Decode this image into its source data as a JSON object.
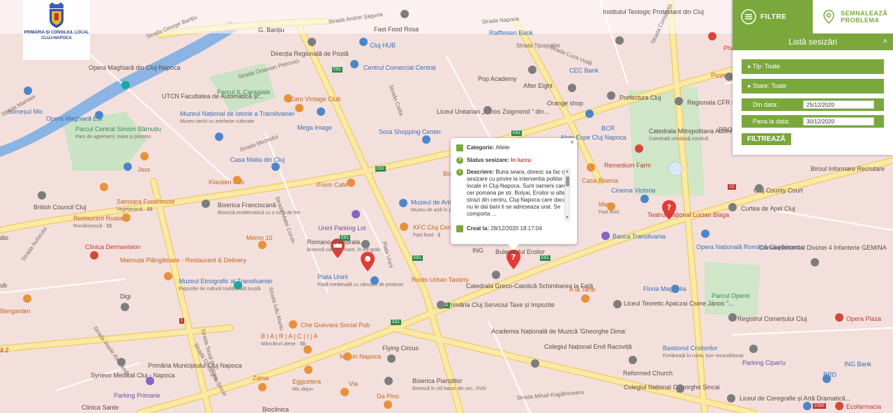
{
  "logo": {
    "line1": "PRIMĂRIA ȘI CONSILIUL LOCAL",
    "line2": "CLUJ-NAPOCA"
  },
  "panel": {
    "tab_filters": "FILTRE",
    "tab_report_line1": "SEMNALEAZĂ",
    "tab_report_line2": "PROBLEMA",
    "list_title": "Listă sesizări",
    "type_filter": "Tip: Toate",
    "state_filter": "Stare: Toate",
    "from_label": "Din data:",
    "from_value": "25/12/2020",
    "to_label": "Pana la data:",
    "to_value": "30/12/2020",
    "filter_button": "FILTREAZĂ"
  },
  "popup": {
    "category_label": "Categorie:",
    "category_value": "Altele",
    "status_label": "Status sesizare:",
    "status_value": "In lucru",
    "description_label": "Descriere:",
    "description_value": "Buna seara, doresc sa fac o sesizare cu privire la interventia politiei locale in Cluj-Napoca. Sunt oameni care cer pomana pe str. Bolyai, Eroilor si alte strazi din centru, Cluj-Napoca care daca nu le dai bani ti se adreseaza urat. Se comporta ...",
    "created_label": "Creat la:",
    "created_value": "28/12/2020 18:17:04",
    "close": "×"
  },
  "map": {
    "colors": {
      "base": "#f3e0dd",
      "road": "#fbe9a6",
      "road_edge": "#f0cf6a",
      "river": "#8ab4e3",
      "park": "#c9e3c4",
      "accent": "#7aa83c",
      "marker": "#e23d34"
    },
    "labels": [
      {
        "t": "Direcția Regională de Poștă",
        "c": "",
        "s": ""
      },
      {
        "t": "Cluj HUB",
        "c": "blue",
        "s": ""
      },
      {
        "t": "Centrul Comercial Central",
        "c": "blue",
        "s": ""
      },
      {
        "t": "Pop Academy",
        "c": "",
        "s": ""
      },
      {
        "t": "After Eight",
        "c": "",
        "s": ""
      },
      {
        "t": "CEC Bank",
        "c": "blue",
        "s": ""
      },
      {
        "t": "Prefectura Cluj",
        "c": "",
        "s": ""
      },
      {
        "t": "Regionala CFR C",
        "c": "",
        "s": ""
      },
      {
        "t": "Opera Maghiară din Cluj-Napoca",
        "c": "",
        "s": ""
      },
      {
        "t": "UTCN Facultatea de Automatică și...",
        "c": "",
        "s": ""
      },
      {
        "t": "Parcul IL Caragiale",
        "c": "green",
        "s": ""
      },
      {
        "t": "Caro Vintage Club",
        "c": "orange",
        "s": ""
      },
      {
        "t": "Liceul Unitarian „János Zsigmond ” din...",
        "c": "",
        "s": ""
      },
      {
        "t": "Orange shop",
        "c": "",
        "s": ""
      },
      {
        "t": "Opera Maghiară Est",
        "c": "blue",
        "s": ""
      },
      {
        "t": "Muzeul Național de Istorie a Transilvaniei",
        "c": "blue",
        "s": "Muzeu vechi cu artefacte culturale"
      },
      {
        "t": "Mega Image",
        "c": "blue",
        "s": ""
      },
      {
        "t": "Sora Shopping Center",
        "c": "blue",
        "s": ""
      },
      {
        "t": "BCR",
        "c": "blue",
        "s": ""
      },
      {
        "t": "Alpin Expe Cluj Napoca",
        "c": "blue",
        "s": ""
      },
      {
        "t": "Catedrala Mitropolitana Adormirea Maicii...",
        "c": "",
        "s": "Catedrală ortodoxă română"
      },
      {
        "t": "Parcul Central Simion Bărnuțiu",
        "c": "green",
        "s": "Parc de agrement, mare și pitoresc"
      },
      {
        "t": "Casa Matia din Cluj",
        "c": "blue",
        "s": ""
      },
      {
        "t": "Remedium Farm",
        "c": "red",
        "s": ""
      },
      {
        "t": "Jaxx",
        "c": "orange",
        "s": ""
      },
      {
        "t": "Klausen Pub",
        "c": "orange",
        "s": ""
      },
      {
        "t": "/Form Cafe",
        "c": "orange",
        "s": ""
      },
      {
        "t": "Casa Boema",
        "c": "orange",
        "s": ""
      },
      {
        "t": "Cinema Victoria",
        "c": "blue",
        "s": ""
      },
      {
        "t": "Biroul Informare Recrutare",
        "c": "",
        "s": ""
      },
      {
        "t": "Cluj County Court",
        "c": "",
        "s": ""
      },
      {
        "t": "British Council Cluj",
        "c": "",
        "s": ""
      },
      {
        "t": "Samsara Foodhouse",
        "c": "orange",
        "s": "Vegetariană · $$"
      },
      {
        "t": "Biserica Franciscană",
        "c": "",
        "s": "Biserică emblematică cu o turlă de fier"
      },
      {
        "t": "Muzeul de Artă",
        "c": "blue",
        "s": "Muzeu de artă în palat baroc"
      },
      {
        "t": "Manu",
        "c": "orange",
        "s": "Fast food"
      },
      {
        "t": "Curtea de Apel Cluj",
        "c": "",
        "s": ""
      },
      {
        "t": "Restaurant Roata",
        "c": "orange",
        "s": "Românească · $$"
      },
      {
        "t": "Unirii Parking Lot",
        "c": "purple",
        "s": ""
      },
      {
        "t": "KFC Cluj Cen",
        "c": "orange",
        "s": "Fast food · $"
      },
      {
        "t": "Teatrul Național Lucian Blaga",
        "c": "red",
        "s": ""
      },
      {
        "t": "Memo 10",
        "c": "orange",
        "s": ""
      },
      {
        "t": "Romano-Catedrala...",
        "c": "",
        "s": "Biserică catolică mare, în stil gotic"
      },
      {
        "t": "Banca Transilvania",
        "c": "blue",
        "s": ""
      },
      {
        "t": "Clinica Dermavision",
        "c": "red",
        "s": ""
      },
      {
        "t": "Opera Națională Română Cluj-Napoca",
        "c": "blue",
        "s": ""
      },
      {
        "t": "Comandamentul Diviziei 4 Infanterie GEMINA",
        "c": "",
        "s": ""
      },
      {
        "t": "Maimuța Plângătoare - Restaurant & Delivery",
        "c": "orange",
        "s": ""
      },
      {
        "t": "Bulevardul Eroilor",
        "c": "",
        "s": ""
      },
      {
        "t": "Roots Urban Tastery",
        "c": "orange",
        "s": ""
      },
      {
        "t": "Piata Unirii",
        "c": "blue",
        "s": "Piață medievală cu vânzare de produse"
      },
      {
        "t": "Muzeul Etnografic al Transilvaniei",
        "c": "blue",
        "s": "Expoziție de cultură tradițională locală"
      },
      {
        "t": "Catedrala Greco-Catolică Schimbarea la Față",
        "c": "",
        "s": ""
      },
      {
        "t": "A la Tarte",
        "c": "orange",
        "s": ""
      },
      {
        "t": "Floria Magnolia",
        "c": "blue",
        "s": ""
      },
      {
        "t": "Digi",
        "c": "",
        "s": ""
      },
      {
        "t": "Primăria Cluj Serviciul Taxe și Impozite",
        "c": "",
        "s": ""
      },
      {
        "t": "Liceul Teoretic Apáczai Csere János \"...",
        "c": "",
        "s": ""
      },
      {
        "t": "Parcul Operei",
        "c": "green",
        "s": ""
      },
      {
        "t": "Registrul Comerțului Cluj",
        "c": "",
        "s": ""
      },
      {
        "t": "Opera Plaza",
        "c": "red",
        "s": ""
      },
      {
        "t": "Bierganten",
        "c": "orange",
        "s": ""
      },
      {
        "t": "Che Guevara Social Pub",
        "c": "orange",
        "s": ""
      },
      {
        "t": "B I A | R | A | C | I | A",
        "c": "orange",
        "s": "Mâncăruri alese · $$"
      },
      {
        "t": "Academia Națională de Muzică 'Gheorghe Dima'",
        "c": "",
        "s": ""
      },
      {
        "t": "Bastionul Croitorilor",
        "c": "blue",
        "s": "Fortăreață în ruine, turn reconditionat"
      },
      {
        "t": "Synevo Medical Cluj - Napoca",
        "c": "",
        "s": ""
      },
      {
        "t": "Primăria Municipiului Cluj Napoca",
        "c": "",
        "s": ""
      },
      {
        "t": "Flying Circus",
        "c": "",
        "s": ""
      },
      {
        "t": "Meron Napoca",
        "c": "orange",
        "s": ""
      },
      {
        "t": "Colegiul Național Emil Racoviță",
        "c": "",
        "s": ""
      },
      {
        "t": "Reformed Church",
        "c": "",
        "s": ""
      },
      {
        "t": "Parking Ciparíu",
        "c": "purple",
        "s": ""
      },
      {
        "t": "ING Bank",
        "c": "blue",
        "s": ""
      },
      {
        "t": "Zama",
        "c": "orange",
        "s": ""
      },
      {
        "t": "Eggcetera",
        "c": "orange",
        "s": "Mic dejun"
      },
      {
        "t": "Via",
        "c": "orange",
        "s": ""
      },
      {
        "t": "Biserica Piariștilor",
        "c": "",
        "s": "Biserică în stil baroc din sec. XVIII"
      },
      {
        "t": "Colegiul Național Gheorghe Șincai",
        "c": "",
        "s": ""
      },
      {
        "t": "Parking Primarie",
        "c": "purple",
        "s": ""
      },
      {
        "t": "Da Pino",
        "c": "orange",
        "s": ""
      },
      {
        "t": "Liceul de Coregrafie și Artă Dramatică...",
        "c": "",
        "s": ""
      },
      {
        "t": "Clinica Sante",
        "c": "",
        "s": ""
      },
      {
        "t": "Bioclinica",
        "c": "",
        "s": ""
      },
      {
        "t": "Ecofarmacia",
        "c": "red",
        "s": ""
      },
      {
        "t": "Pharmacy",
        "c": "red",
        "s": ""
      },
      {
        "t": "Pizzeri",
        "c": "orange",
        "s": ""
      },
      {
        "t": "PROF",
        "c": "",
        "s": ""
      },
      {
        "t": "dio",
        "c": "",
        "s": ""
      },
      {
        "t": "ub",
        "c": "",
        "s": ""
      },
      {
        "t": "ă 2",
        "c": "red",
        "s": ""
      },
      {
        "t": "Institutul Teologic Protestant din Cluj",
        "c": "",
        "s": ""
      },
      {
        "t": "Fast Food Rosa",
        "c": "",
        "s": ""
      },
      {
        "t": "Raiffeisen Bank",
        "c": "blue",
        "s": ""
      },
      {
        "t": "G. Barițiu",
        "c": "",
        "s": ""
      },
      {
        "t": "ING",
        "c": "",
        "s": ""
      },
      {
        "t": "BRD",
        "c": "blue",
        "s": ""
      },
      {
        "t": "Bis",
        "c": "orange",
        "s": ""
      },
      {
        "t": "Someșul Mic",
        "c": "blue",
        "s": ""
      }
    ],
    "streets": [
      "Strada George Barițiu",
      "Strada Andrei Șaguna",
      "Strada Tipografiei",
      "Strada Cuza Vodă",
      "Strada Constanța",
      "Strada Octavian Petrovici",
      "Strada Cotita",
      "Strada Muzeului",
      "Strada Matei Corvin",
      "Piața Unirii",
      "Strada Iuliu Maniu",
      "Strada Sextil Pușcariu",
      "Strada Gheorghe Șincai",
      "Strada Vasile Alecsandri",
      "Strada Mihail Kogălniceanu",
      "Strada Memorandumului",
      "Strada Napoca",
      "Strada Mamaia",
      "Strada Nufarului"
    ],
    "road_shields": [
      "E81",
      "E81",
      "E81",
      "E81",
      "E81",
      "E81",
      "E81",
      "E81",
      "1C",
      "1",
      "103G"
    ]
  }
}
